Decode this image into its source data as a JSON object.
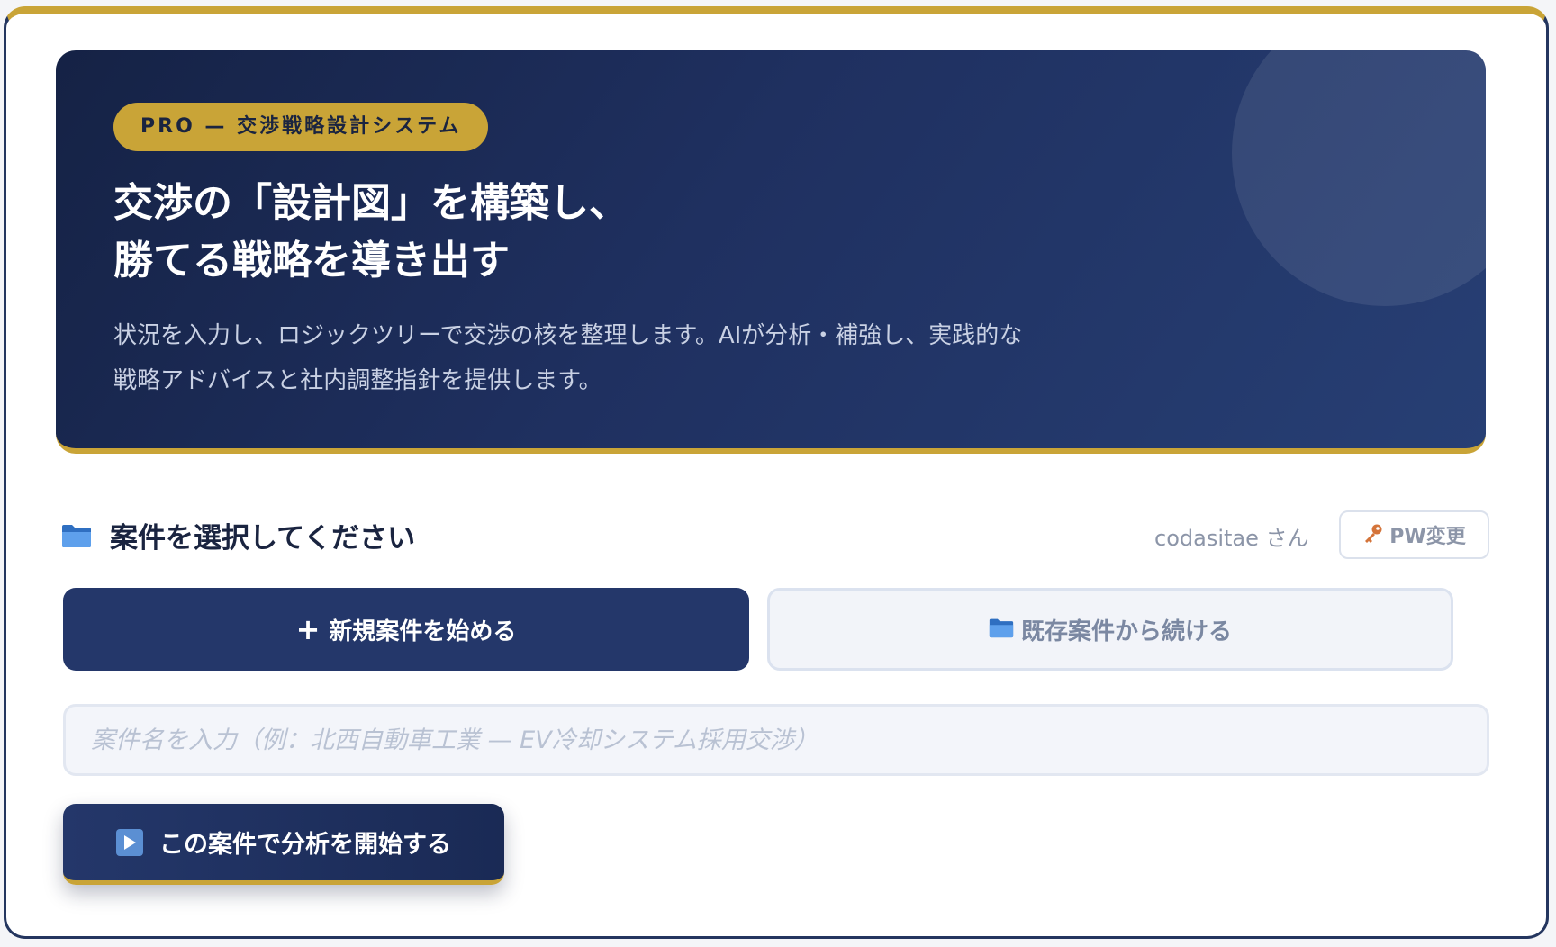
{
  "hero": {
    "badge": "PRO — 交渉戦略設計システム",
    "title_line1": "交渉の「設計図」を構築し、",
    "title_line2": "勝てる戦略を導き出す",
    "desc_line1": "状況を入力し、ロジックツリーで交渉の核を整理します。AIが分析・補強し、実践的な",
    "desc_line2": "戦略アドバイスと社内調整指針を提供します。"
  },
  "section": {
    "icon": "folder-icon",
    "title": "案件を選択してください"
  },
  "user": {
    "name": "codasitae さん",
    "pw_button_icon": "key-icon",
    "pw_button": "PW変更"
  },
  "actions": {
    "new_case_icon": "plus-icon",
    "new_case": "新規案件を始める",
    "continue_icon": "folder-icon",
    "continue_case": "既存案件から続ける"
  },
  "case_input": {
    "placeholder": "案件名を入力（例：北西自動車工業 — EV冷却システム採用交渉）",
    "value": ""
  },
  "start": {
    "icon": "play-icon",
    "label": "この案件で分析を開始する"
  },
  "colors": {
    "navy": "#24376a",
    "gold": "#c9a437",
    "hero_dark": "#152245",
    "folder_blue": "#4a8ee0"
  }
}
